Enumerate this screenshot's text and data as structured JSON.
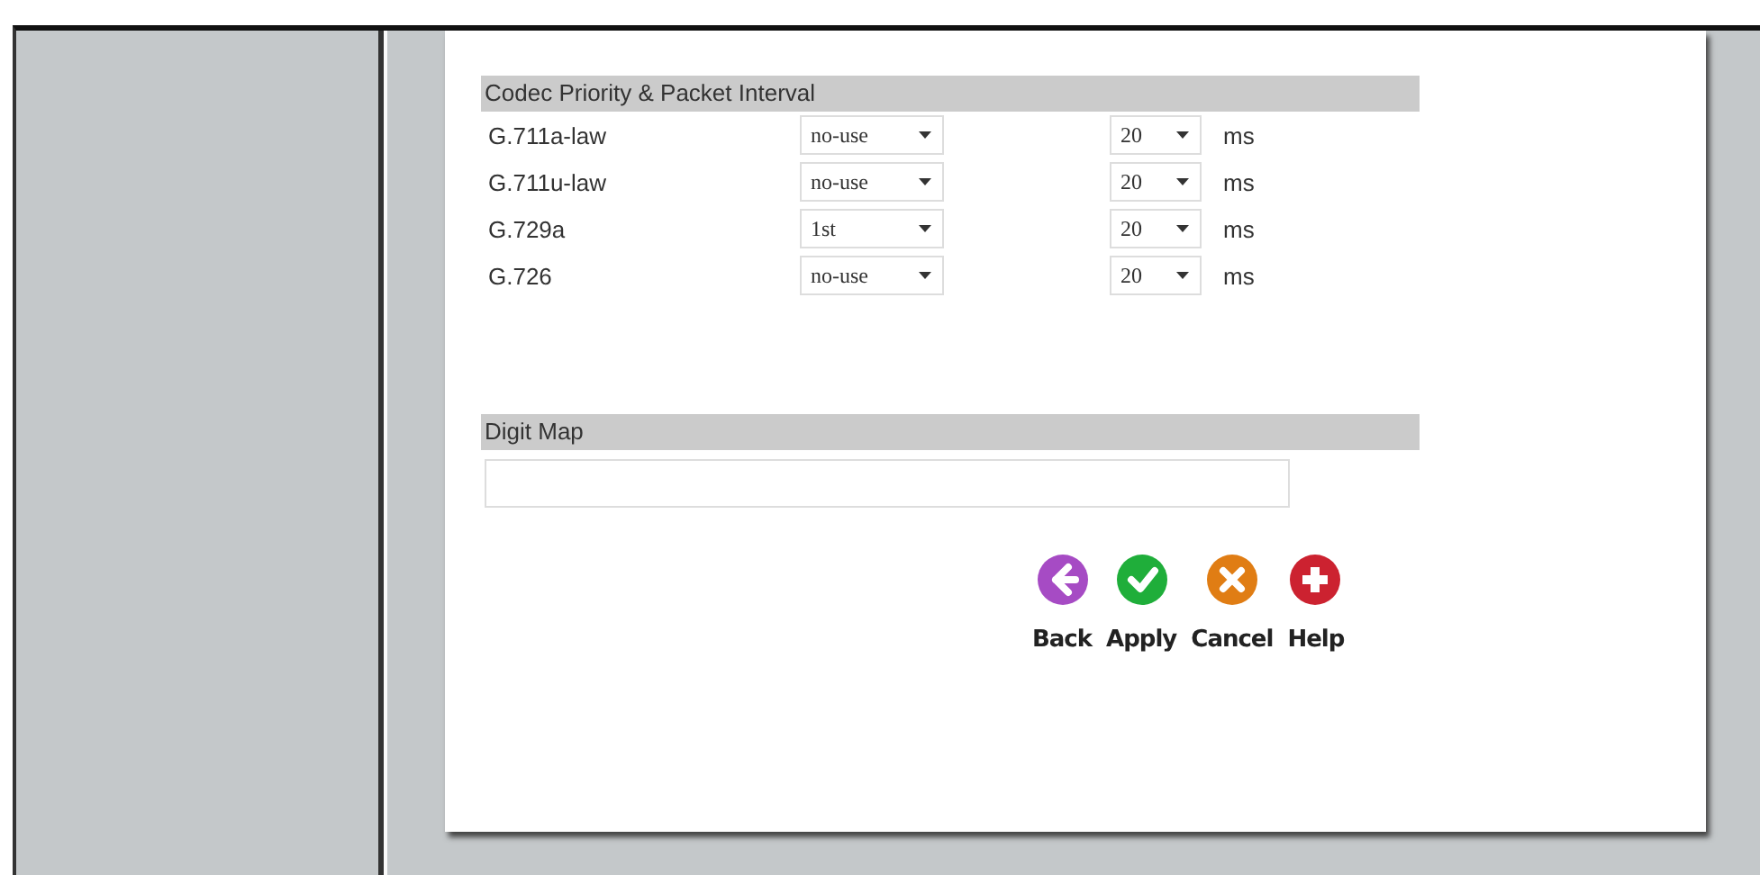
{
  "codec_section": {
    "title": "Codec Priority & Packet Interval",
    "rows": [
      {
        "codec": "G.711a-law",
        "priority": "no-use",
        "interval": "20",
        "unit": "ms"
      },
      {
        "codec": "G.711u-law",
        "priority": "no-use",
        "interval": "20",
        "unit": "ms"
      },
      {
        "codec": "G.729a",
        "priority": "1st",
        "interval": "20",
        "unit": "ms"
      },
      {
        "codec": "G.726",
        "priority": "no-use",
        "interval": "20",
        "unit": "ms"
      }
    ]
  },
  "digit_map": {
    "title": "Digit Map"
  },
  "buttons": [
    {
      "kind": "back",
      "label": "Back"
    },
    {
      "kind": "apply",
      "label": "Apply"
    },
    {
      "kind": "cancel",
      "label": "Cancel"
    },
    {
      "kind": "help",
      "label": "Help"
    }
  ]
}
